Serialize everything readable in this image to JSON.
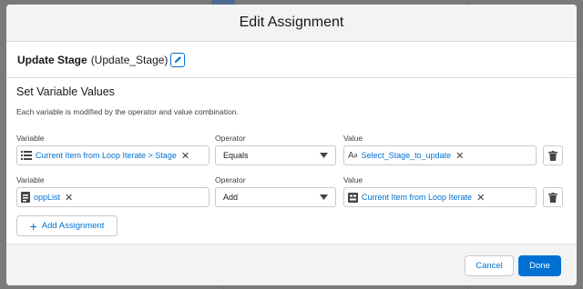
{
  "modal": {
    "title": "Edit Assignment"
  },
  "element": {
    "label": "Update Stage",
    "api_name": "(Update_Stage)"
  },
  "section": {
    "title": "Set Variable Values",
    "description": "Each variable is modified by the operator and value combination."
  },
  "columns": {
    "variable": "Variable",
    "operator": "Operator",
    "value": "Value"
  },
  "rows": [
    {
      "variable": "Current Item from Loop Iterate > Stage",
      "variable_icon": "list-icon",
      "operator": "Equals",
      "value": "Select_Stage_to_update",
      "value_icon": "text-type-icon"
    },
    {
      "variable": "oppList",
      "variable_icon": "collection-icon",
      "operator": "Add",
      "value": "Current Item from Loop Iterate",
      "value_icon": "record-icon"
    }
  ],
  "buttons": {
    "add": "Add Assignment",
    "cancel": "Cancel",
    "done": "Done"
  },
  "colors": {
    "accent": "#0070d2",
    "header_bg": "#f3f3f3",
    "border": "#dddbda"
  }
}
